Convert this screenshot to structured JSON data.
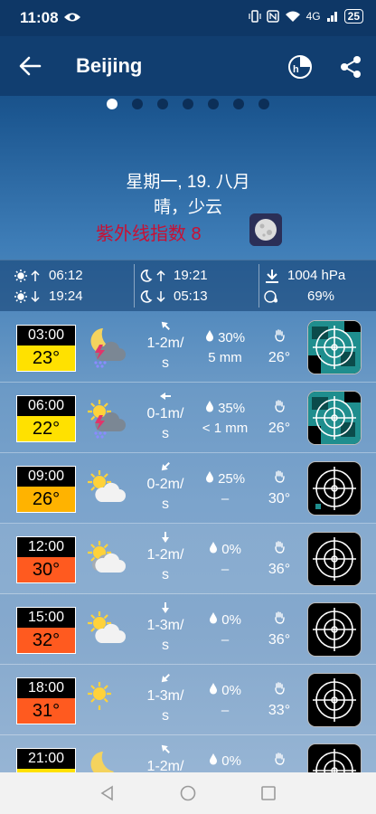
{
  "status_bar": {
    "time": "11:08",
    "network": "4G",
    "battery": "25"
  },
  "header": {
    "title": "Beijing"
  },
  "pager": {
    "count": 7,
    "active": 0
  },
  "summary": {
    "date": "星期一, 19. 八月",
    "condition": "晴，少云",
    "uv_index": "紫外线指数 8"
  },
  "astro": {
    "sunrise": "06:12",
    "sunset": "19:24",
    "moonrise": "19:21",
    "moonset": "05:13",
    "pressure": "1004 hPa",
    "humidity": "69%"
  },
  "hours": [
    {
      "time": "03:00",
      "temp": "23°",
      "temp_color": "#ffe100",
      "icon": "night-thunder-snow-icon",
      "wind1": "1-2m/",
      "wind2": "s",
      "wind_dir": "nw",
      "precip_prob": "30%",
      "precip_amt": "5 mm",
      "feels": "26°",
      "radar": "active"
    },
    {
      "time": "06:00",
      "temp": "22°",
      "temp_color": "#ffe100",
      "icon": "day-thunder-snow-icon",
      "wind1": "0-1m/",
      "wind2": "s",
      "wind_dir": "w",
      "precip_prob": "35%",
      "precip_amt": "< 1 mm",
      "feels": "26°",
      "radar": "active"
    },
    {
      "time": "09:00",
      "temp": "26°",
      "temp_color": "#ffb300",
      "icon": "sun-cloud-icon",
      "wind1": "0-2m/",
      "wind2": "s",
      "wind_dir": "sw",
      "precip_prob": "25%",
      "precip_amt": "–",
      "feels": "30°",
      "radar": "small"
    },
    {
      "time": "12:00",
      "temp": "30°",
      "temp_color": "#ff5a1f",
      "icon": "sun-cloudy-icon",
      "wind1": "1-2m/",
      "wind2": "s",
      "wind_dir": "s",
      "precip_prob": "0%",
      "precip_amt": "–",
      "feels": "36°",
      "radar": "none"
    },
    {
      "time": "15:00",
      "temp": "32°",
      "temp_color": "#ff5a1f",
      "icon": "sun-cloud-icon",
      "wind1": "1-3m/",
      "wind2": "s",
      "wind_dir": "s",
      "precip_prob": "0%",
      "precip_amt": "–",
      "feels": "36°",
      "radar": "none"
    },
    {
      "time": "18:00",
      "temp": "31°",
      "temp_color": "#ff5a1f",
      "icon": "sun-icon",
      "wind1": "1-3m/",
      "wind2": "s",
      "wind_dir": "sw",
      "precip_prob": "0%",
      "precip_amt": "–",
      "feels": "33°",
      "radar": "none"
    },
    {
      "time": "21:00",
      "temp": "",
      "temp_color": "#ffe100",
      "icon": "moon-icon",
      "wind1": "1-2m/",
      "wind2": "",
      "wind_dir": "nw",
      "precip_prob": "0%",
      "precip_amt": "",
      "feels": "",
      "radar": "none"
    }
  ],
  "colors": {
    "status_bg": "#0e3766",
    "appbar_bg": "#113e70",
    "uv_text": "#c81034"
  }
}
